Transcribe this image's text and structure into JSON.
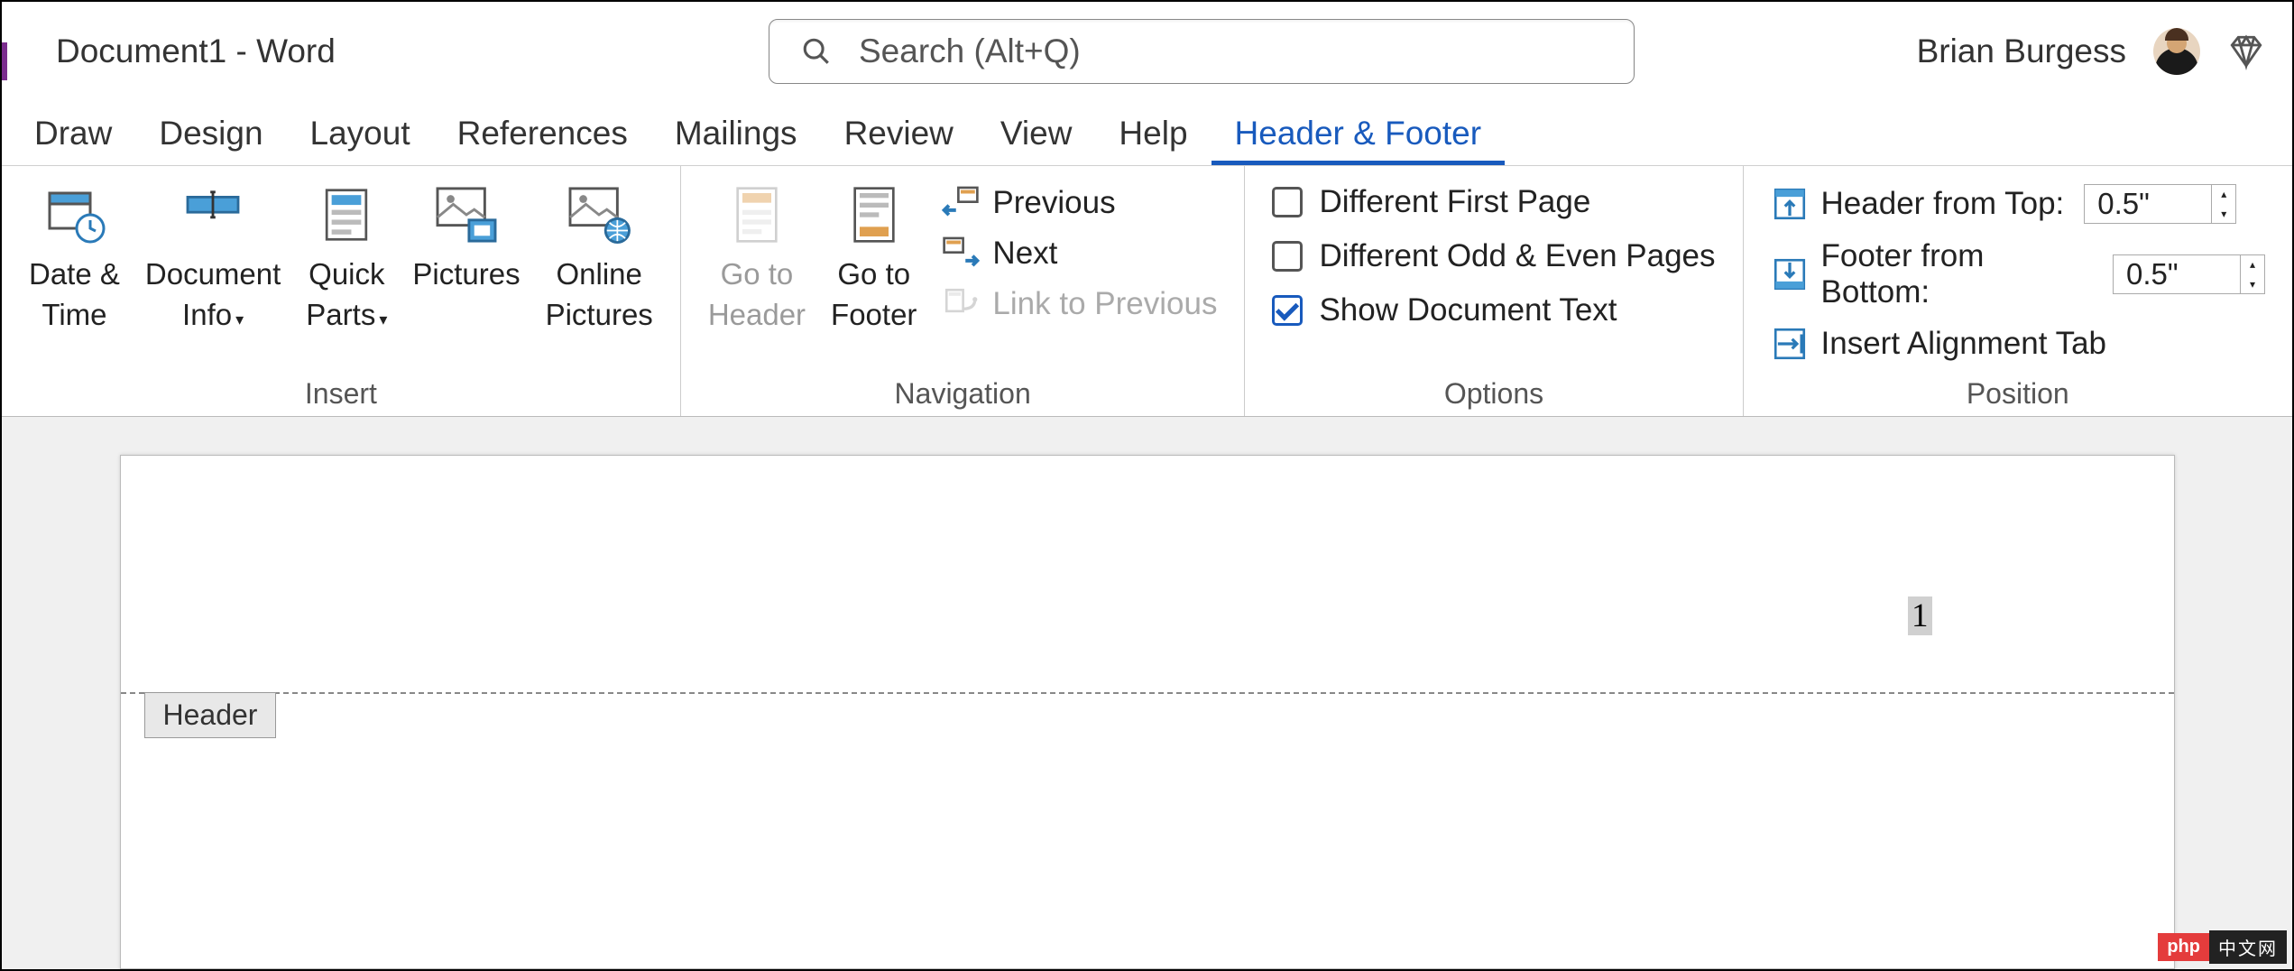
{
  "title": "Document1  -  Word",
  "search": {
    "placeholder": "Search (Alt+Q)"
  },
  "user": {
    "name": "Brian Burgess"
  },
  "tabs": [
    "Draw",
    "Design",
    "Layout",
    "References",
    "Mailings",
    "Review",
    "View",
    "Help",
    "Header & Footer"
  ],
  "active_tab": "Header & Footer",
  "ribbon": {
    "insert": {
      "label": "Insert",
      "date_time": "Date &\nTime",
      "doc_info": "Document\nInfo",
      "quick_parts": "Quick\nParts",
      "pictures": "Pictures",
      "online_pictures": "Online\nPictures"
    },
    "navigation": {
      "label": "Navigation",
      "go_header": "Go to\nHeader",
      "go_footer": "Go to\nFooter",
      "previous": "Previous",
      "next": "Next",
      "link_prev": "Link to Previous"
    },
    "options": {
      "label": "Options",
      "diff_first": "Different First Page",
      "diff_odd_even": "Different Odd & Even Pages",
      "show_doc_text": "Show Document Text",
      "diff_first_checked": false,
      "diff_odd_even_checked": false,
      "show_doc_text_checked": true
    },
    "position": {
      "label": "Position",
      "header_top": "Header from Top:",
      "footer_bottom": "Footer from Bottom:",
      "header_val": "0.5\"",
      "footer_val": "0.5\"",
      "align_tab": "Insert Alignment Tab"
    }
  },
  "page": {
    "number": "1",
    "header_label": "Header"
  },
  "watermark": {
    "a": "php",
    "b": "中文网"
  }
}
